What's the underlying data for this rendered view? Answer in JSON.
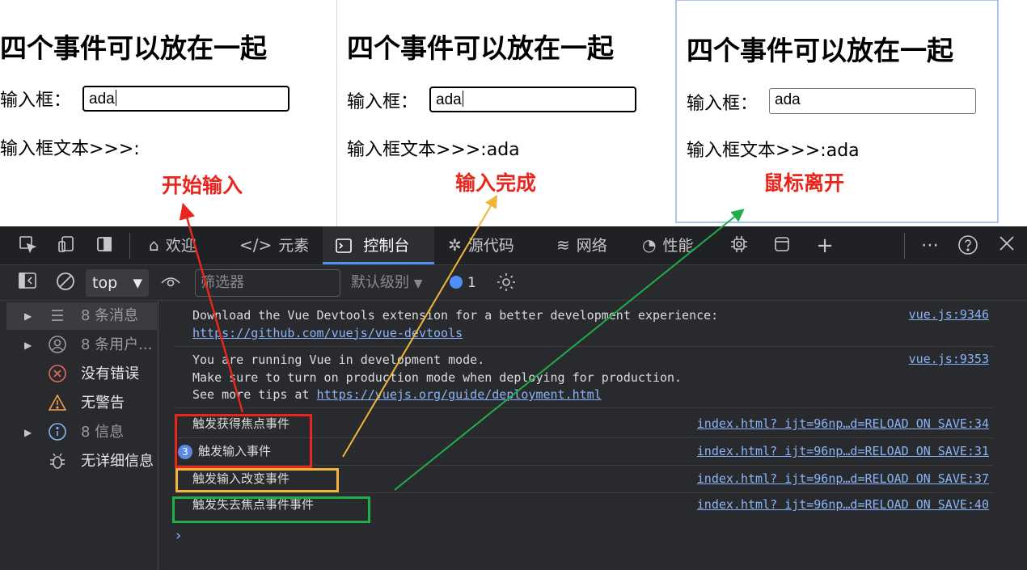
{
  "snapshots": [
    {
      "heading": "四个事件可以放在一起",
      "input_label": "输入框：",
      "input_value": "ada",
      "output_label": "输入框文本>>>:",
      "output_value": "",
      "annotation": "开始输入"
    },
    {
      "heading": "四个事件可以放在一起",
      "input_label": "输入框：",
      "input_value": "ada",
      "output_label": "输入框文本>>>:",
      "output_value": "ada",
      "annotation": "输入完成"
    },
    {
      "heading": "四个事件可以放在一起",
      "input_label": "输入框：",
      "input_value": "ada",
      "output_label": "输入框文本>>>:",
      "output_value": "ada",
      "annotation": "鼠标离开"
    }
  ],
  "devtools": {
    "tabs": [
      {
        "icon": "home-icon",
        "label": "欢迎"
      },
      {
        "icon": "code-icon",
        "label": "元素"
      },
      {
        "icon": "console-icon",
        "label": "控制台"
      },
      {
        "icon": "bug-icon",
        "label": "源代码"
      },
      {
        "icon": "wifi-icon",
        "label": "网络"
      },
      {
        "icon": "gauge-icon",
        "label": "性能"
      }
    ],
    "toolbar": {
      "context": "top",
      "filter_placeholder": "筛选器",
      "levels": "默认级别",
      "message_count": "1"
    },
    "sidebar": [
      {
        "icon": "list-icon",
        "label": "8 条消息"
      },
      {
        "icon": "user-icon",
        "label": "8 条用户..."
      },
      {
        "icon": "error-icon",
        "label": "没有错误"
      },
      {
        "icon": "warning-icon",
        "label": "无警告"
      },
      {
        "icon": "info-icon",
        "label": "8 信息"
      },
      {
        "icon": "verbose-icon",
        "label": "无详细信息"
      }
    ],
    "console": {
      "entries": [
        {
          "line1": "Download the Vue Devtools extension for a better development experience:",
          "link": "https://github.com/vuejs/vue-devtools",
          "source": "vue.js:9346"
        },
        {
          "line1": "You are running Vue in development mode.",
          "line2": "Make sure to turn on production mode when deploying for production.",
          "line3_prefix": "See more tips at ",
          "link": "https://vuejs.org/guide/deployment.html",
          "source": "vue.js:9353"
        },
        {
          "text": "触发获得焦点事件",
          "source": "index.html? ijt=96np…d=RELOAD ON SAVE:34"
        },
        {
          "count": "3",
          "text": "触发输入事件",
          "source": "index.html? ijt=96np…d=RELOAD ON SAVE:31"
        },
        {
          "text": "触发输入改变事件",
          "source": "index.html? ijt=96np…d=RELOAD ON SAVE:37"
        },
        {
          "text": "触发失去焦点事件事件",
          "source": "index.html? ijt=96np…d=RELOAD ON SAVE:40"
        }
      ],
      "prompt": "›"
    }
  },
  "colors": {
    "annotation_red": "#e8261e",
    "arrow_red": "#e8261e",
    "arrow_yellow": "#f0b53a",
    "arrow_green": "#1fae4a",
    "devtools_bg": "#292a2d",
    "link_blue": "#8ab4f8"
  }
}
